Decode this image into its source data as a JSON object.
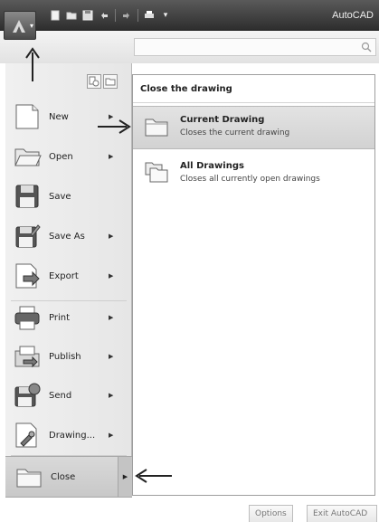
{
  "titlebar": {
    "title": "AutoCAD",
    "app_button_caret": "▾",
    "qat_more": "▾"
  },
  "search": {
    "placeholder": ""
  },
  "menu": {
    "items": [
      {
        "label": "New",
        "icon": "new-file-icon"
      },
      {
        "label": "Open",
        "icon": "open-folder-icon"
      },
      {
        "label": "Save",
        "icon": "save-icon"
      },
      {
        "label": "Save As",
        "icon": "save-as-icon"
      },
      {
        "label": "Export",
        "icon": "export-icon"
      },
      {
        "label": "Print",
        "icon": "printer-icon"
      },
      {
        "label": "Publish",
        "icon": "publish-icon"
      },
      {
        "label": "Send",
        "icon": "send-icon"
      },
      {
        "label": "Drawing...",
        "icon": "drawing-utilities-icon"
      },
      {
        "label": "Close",
        "icon": "close-folder-icon"
      }
    ],
    "arrow": "▶"
  },
  "submenu": {
    "title": "Close the drawing",
    "items": [
      {
        "title": "Current Drawing",
        "description": "Closes the current drawing",
        "icon": "folder-icon"
      },
      {
        "title": "All Drawings",
        "description": "Closes all currently open drawings",
        "icon": "folders-icon"
      }
    ]
  },
  "footer": {
    "options_label": "Options",
    "exit_label": "Exit AutoCAD"
  },
  "colors": {
    "titlebar": "#3a3a3a",
    "highlight": "#d2d2d2",
    "annotation_arrow": "#222222"
  }
}
